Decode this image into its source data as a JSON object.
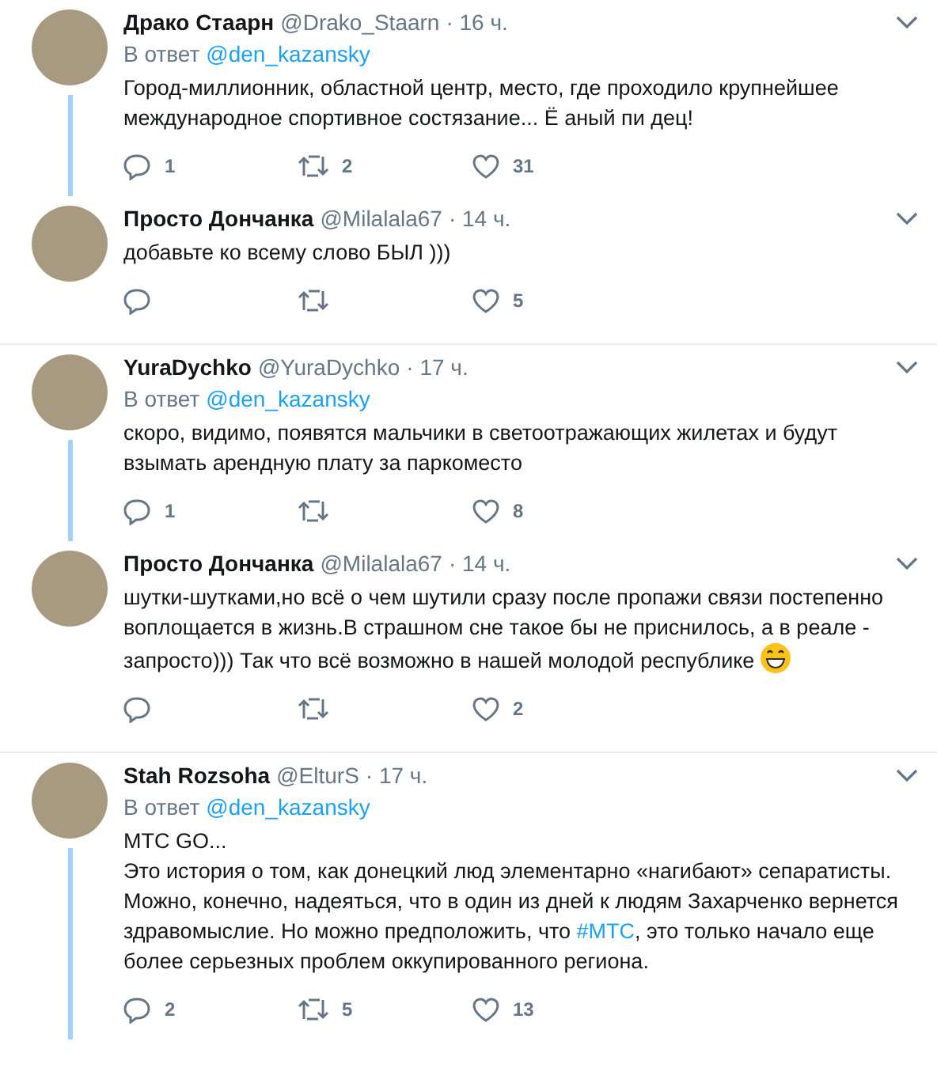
{
  "tweets": [
    {
      "name": "Драко Стаарн",
      "handle": "@Drako_Staarn",
      "time": "· 16 ч.",
      "reply_to": {
        "prefix": "В ответ",
        "user": "@den_kazansky"
      },
      "body": [
        {
          "kind": "text",
          "text": "Город-миллионник, областной центр, место, где проходило крупнейшее международное спортивное состязание... Ё аный пи дец!"
        }
      ],
      "replies": "1",
      "retweets": "2",
      "likes": "31",
      "thread": true
    },
    {
      "name": "Просто Дончанка",
      "handle": "@Milalala67",
      "time": "· 14 ч.",
      "body": [
        {
          "kind": "text",
          "text": "добавьте ко всему слово БЫЛ )))"
        }
      ],
      "likes": "5",
      "thread": false
    },
    {
      "name": "YuraDychko",
      "handle": "@YuraDychko",
      "time": "· 17 ч.",
      "reply_to": {
        "prefix": "В ответ",
        "user": "@den_kazansky"
      },
      "body": [
        {
          "kind": "text",
          "text": "скоро, видимо, появятся мальчики в светоотражающих жилетах и будут взымать арендную плату за паркоместо"
        }
      ],
      "replies": "1",
      "likes": "8",
      "thread": true
    },
    {
      "name": "Просто Дончанка",
      "handle": "@Milalala67",
      "time": "· 14 ч.",
      "body": [
        {
          "kind": "text",
          "text": "шутки-шутками,но всё о чем шутили сразу после пропажи связи постепенно воплощается в жизнь.В страшном сне такое бы не приснилось, а в реале - запросто))) Так что всё возможно в нашей молодой республике "
        },
        {
          "kind": "emoji"
        }
      ],
      "likes": "2",
      "thread": false
    },
    {
      "name": "Stah Rozsoha",
      "handle": "@ElturS",
      "time": "· 17 ч.",
      "reply_to": {
        "prefix": "В ответ",
        "user": "@den_kazansky"
      },
      "body": [
        {
          "kind": "text",
          "text": "MTC GO...\nЭто история о том, как донецкий люд элементарно «нагибают» сепаратисты. Можно, конечно, надеяться, что в один из дней к людям Захарченко вернется здравомыслие. Но можно предположить, что "
        },
        {
          "kind": "hashtag",
          "text": "#МТС"
        },
        {
          "kind": "text",
          "text": ", это только начало еще более серьезных проблем оккупированного региона."
        }
      ],
      "replies": "2",
      "retweets": "5",
      "likes": "13",
      "thread": true
    }
  ]
}
